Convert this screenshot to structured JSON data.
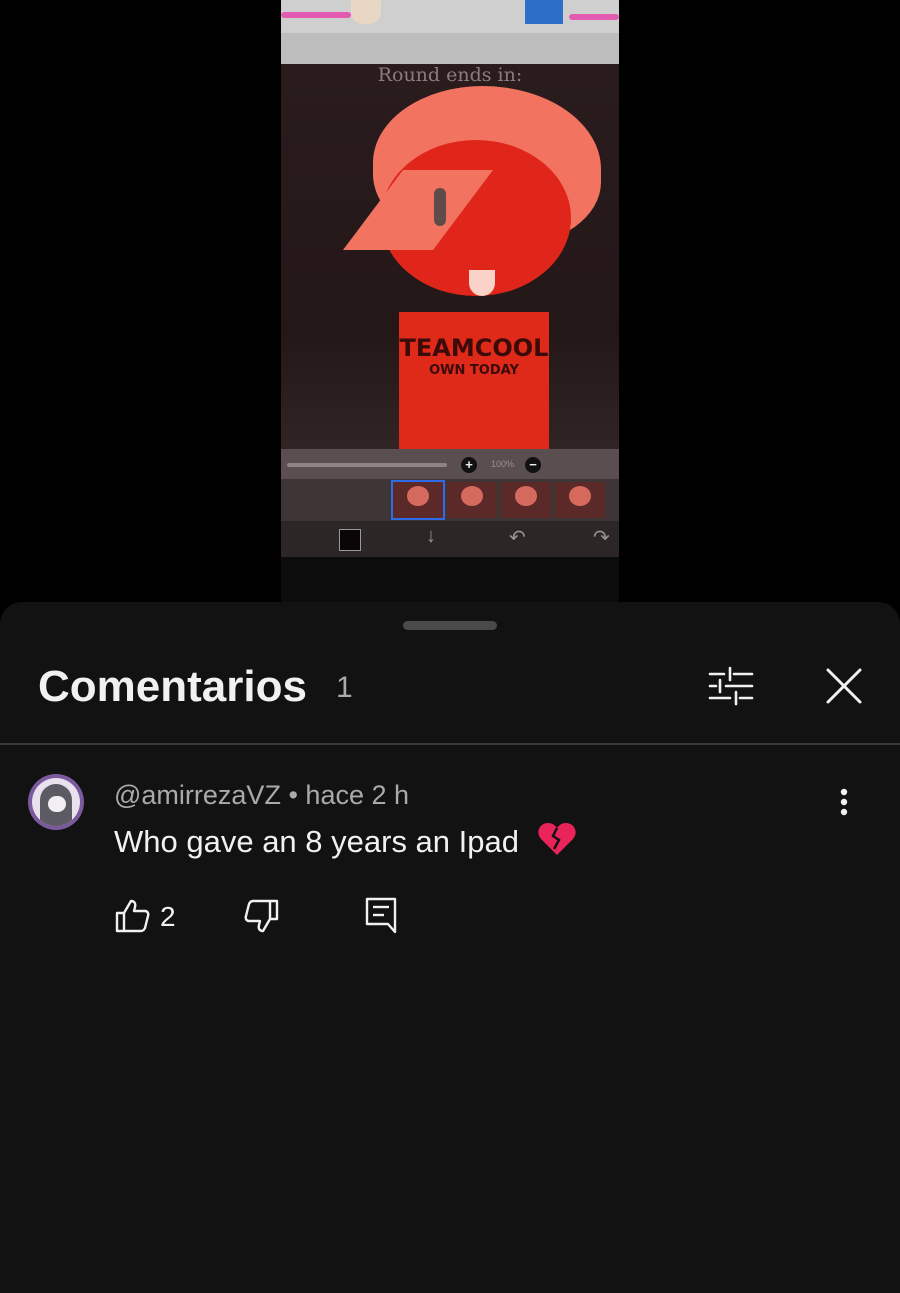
{
  "video": {
    "overlay_text": "Round ends in:",
    "shirt_line1": "TEAMCOOL",
    "shirt_line2": "OWN TODAY",
    "zoom_label": "100%"
  },
  "comments_panel": {
    "title": "Comentarios",
    "count": "1",
    "filter_icon": "tune-icon",
    "close_icon": "close-icon"
  },
  "comments": [
    {
      "author": "@amirrezaVZ",
      "separator": "•",
      "time": "hace 2 h",
      "text": "Who gave an 8 years an Ipad",
      "emoji_icon": "broken-heart-icon",
      "likes": "2"
    }
  ],
  "colors": {
    "sheet_bg": "#121212",
    "text_primary": "#f1f1f1",
    "text_secondary": "#aaaaaa",
    "avatar_ring": "#7a5a9c"
  }
}
